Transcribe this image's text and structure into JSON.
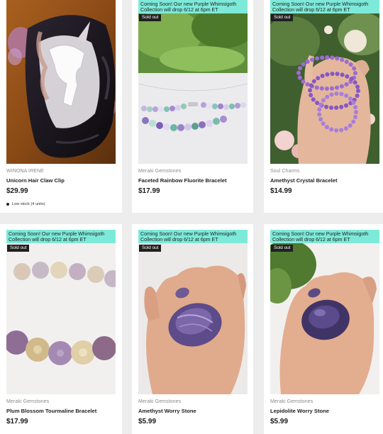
{
  "banner_text": "Coming Soon! Our new Purple Whimsigoth Collection will drop 6/12 at 6pm ET",
  "sold_out_label": "Sold out",
  "products": [
    {
      "vendor": "WINONA IRENE",
      "title": "Unicorn Hair Claw Clip",
      "price": "$29.99",
      "stock": "Low stock (4 units)"
    },
    {
      "vendor": "Meraki Gemstones",
      "title": "Faceted Rainbow Fluorite Bracelet",
      "price": "$17.99"
    },
    {
      "vendor": "Soul Charms",
      "title": "Amethyst Crystal Bracelet",
      "price": "$14.99"
    },
    {
      "vendor": "Meraki Gemstones",
      "title": "Plum Blossom Tourmaline Bracelet",
      "price": "$17.99"
    },
    {
      "vendor": "Meraki Gemstones",
      "title": "Amethyst Worry Stone",
      "price": "$5.99"
    },
    {
      "vendor": "Meraki Gemstones",
      "title": "Lepidolite Worry Stone",
      "price": "$5.99"
    }
  ],
  "colors": {
    "banner": "#7dead9",
    "sold_out_bg": "#202020",
    "page_bg": "#ededed"
  }
}
